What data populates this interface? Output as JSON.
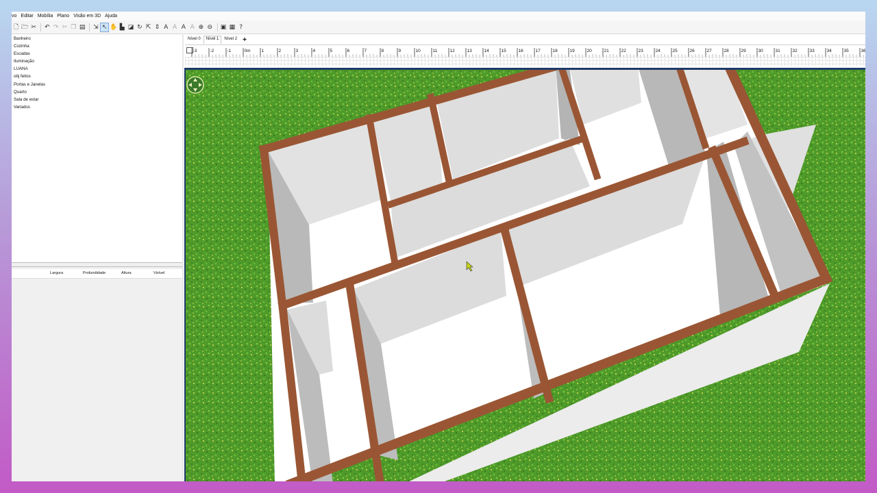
{
  "menu": [
    "vo",
    "Editar",
    "Mobília",
    "Plano",
    "Visão em 3D",
    "Ajuda"
  ],
  "toolbar_icons": [
    "new-home-icon",
    "open-icon",
    "cut-scissors-icon",
    "undo-icon",
    "redo-icon",
    "cut-icon",
    "copy-icon",
    "paste-icon",
    "add-furniture-icon",
    "select-arrow-icon",
    "pan-hand-icon",
    "create-walls-icon",
    "create-rooms-icon",
    "create-polylines-icon",
    "create-dimensions-icon",
    "add-text-icon",
    "text-style-icon",
    "increase-text-icon",
    "decrease-text-icon",
    "zoom-in-icon",
    "zoom-out-icon",
    "create-photo-icon",
    "create-video-icon",
    "help-icon"
  ],
  "catalog": {
    "items": [
      "Banheiro",
      "Cozinha",
      "Escadas",
      "Iluminação",
      "LUANA",
      "obj feitos",
      "Portas e Janelas",
      "Quarto",
      "Sala de estar",
      "Variados"
    ]
  },
  "furniture_table": {
    "columns": [
      "Largura",
      "Profundidade",
      "Altura",
      "Visível"
    ]
  },
  "levels": {
    "tabs": [
      "Nível 0",
      "Nível 1",
      "Nível 2"
    ],
    "selected": "Nível 1",
    "add": "+"
  },
  "ruler": {
    "labels": [
      "-3",
      "-2",
      "-1",
      "0m",
      "1",
      "2",
      "3",
      "4",
      "5",
      "6",
      "7",
      "8",
      "9",
      "10",
      "11",
      "12",
      "13",
      "14",
      "15",
      "16",
      "17",
      "18",
      "19",
      "20",
      "21",
      "22",
      "23",
      "24",
      "25",
      "26",
      "27",
      "28",
      "29",
      "30",
      "31",
      "32",
      "33",
      "34",
      "35",
      "36"
    ]
  },
  "view3d": {
    "wall_color": "#9a5634",
    "grass_color": "#4e9a2a",
    "navigator": "navigation-arrows-icon"
  }
}
